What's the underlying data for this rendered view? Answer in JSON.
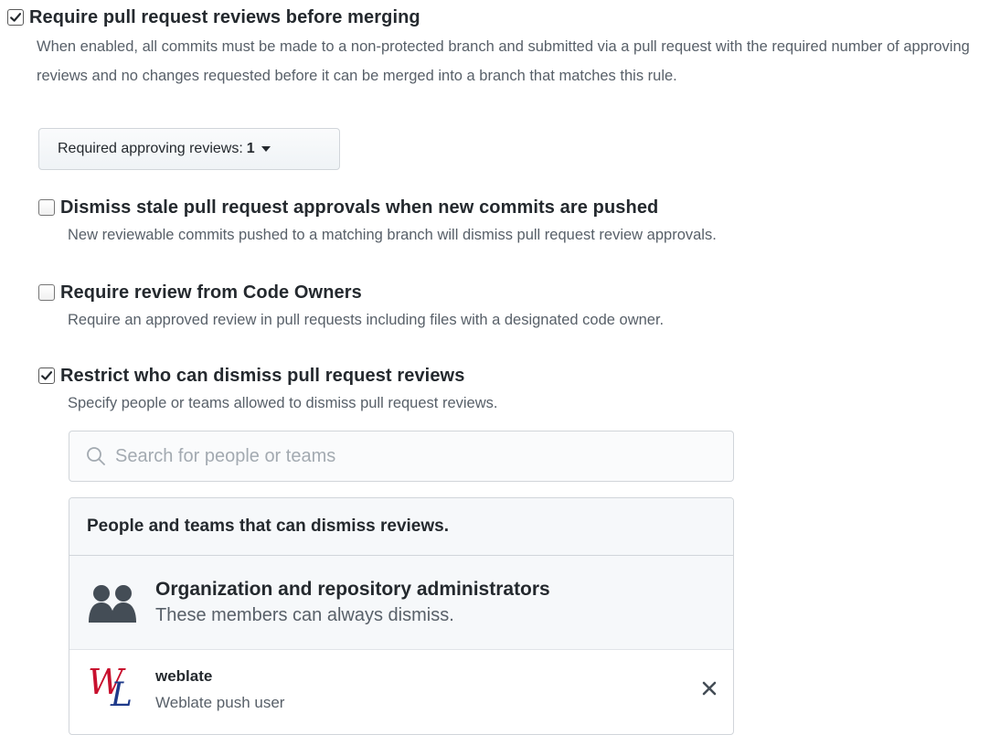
{
  "options": [
    {
      "title": "Require pull request reviews before merging",
      "checked": true,
      "description": "When enabled, all commits must be made to a non-protected branch and submitted via a pull request with the required number of approving reviews and no changes requested before it can be merged into a branch that matches this rule."
    },
    {
      "title": "Dismiss stale pull request approvals when new commits are pushed",
      "checked": false,
      "description": "New reviewable commits pushed to a matching branch will dismiss pull request review approvals."
    },
    {
      "title": "Require review from Code Owners",
      "checked": false,
      "description": "Require an approved review in pull requests including files with a designated code owner."
    },
    {
      "title": "Restrict who can dismiss pull request reviews",
      "checked": true,
      "description": "Specify people or teams allowed to dismiss pull request reviews."
    }
  ],
  "reviews_dropdown": {
    "label": "Required approving reviews:",
    "value": "1"
  },
  "search": {
    "placeholder": "Search for people or teams",
    "value": ""
  },
  "dismiss_panel": {
    "header": "People and teams that can dismiss reviews.",
    "admins": {
      "title": "Organization and repository administrators",
      "description": "These members can always dismiss.",
      "icon": "people-icon"
    },
    "users": [
      {
        "name": "weblate",
        "description": "Weblate push user",
        "avatar_letters": {
          "first": "W",
          "second": "L"
        },
        "icon": "weblate-logo",
        "remove_glyph": "✕"
      }
    ]
  },
  "colors": {
    "text": "#24292e",
    "muted": "#586069",
    "border": "#d1d5da",
    "panel_bg": "#f6f8fa",
    "logo_red": "#c8102e",
    "logo_blue": "#1e3a8a"
  }
}
